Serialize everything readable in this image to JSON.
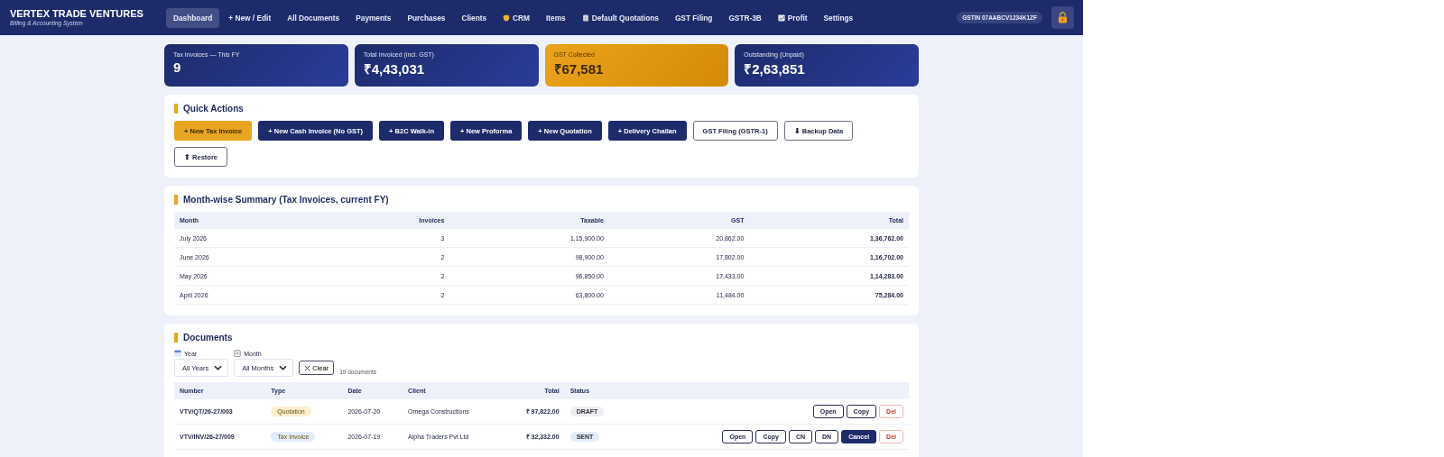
{
  "brand": {
    "title": "VERTEX TRADE VENTURES",
    "subtitle": "Billing & Accounting System"
  },
  "nav": [
    {
      "label": "Dashboard",
      "selected": true
    },
    {
      "label": "+ New / Edit",
      "selected": false
    },
    {
      "label": "All Documents",
      "selected": false
    },
    {
      "label": "Payments",
      "selected": false
    },
    {
      "label": "Purchases",
      "selected": false
    },
    {
      "label": "Clients",
      "selected": false
    },
    {
      "label": "CRM",
      "selected": false
    },
    {
      "label": "Items",
      "selected": false
    },
    {
      "label": "Default Quotations",
      "selected": false
    },
    {
      "label": "GST Filing",
      "selected": false
    },
    {
      "label": "GSTR-3B",
      "selected": false
    },
    {
      "label": "Profit",
      "selected": false
    },
    {
      "label": "Settings",
      "selected": false
    }
  ],
  "gstin": "GSTIN 07AABCV1234K1ZF",
  "stats": [
    {
      "label": "Tax Invoices — This FY",
      "value": "9",
      "kind": "primary"
    },
    {
      "label": "Total Invoiced (incl. GST)",
      "value": "₹4,43,031",
      "kind": "primary"
    },
    {
      "label": "GST Collected",
      "value": "₹67,581",
      "kind": "accent"
    },
    {
      "label": "Outstanding (Unpaid)",
      "value": "₹2,63,851",
      "kind": "primary"
    }
  ],
  "quick_actions": {
    "title": "Quick Actions",
    "buttons": [
      {
        "label": "+ New Tax Invoice",
        "kind": "accent"
      },
      {
        "label": "+ New Cash Invoice (No GST)",
        "kind": "dark"
      },
      {
        "label": "+ B2C Walk-in",
        "kind": "dark"
      },
      {
        "label": "+ New Proforma",
        "kind": "dark"
      },
      {
        "label": "+ New Quotation",
        "kind": "dark"
      },
      {
        "label": "+ Delivery Challan",
        "kind": "dark"
      },
      {
        "label": "GST Filing (GSTR-1)",
        "kind": "outline"
      },
      {
        "label": "⬇ Backup Data",
        "kind": "outline"
      },
      {
        "label": "⬆ Restore",
        "kind": "outline"
      }
    ]
  },
  "summary": {
    "title": "Month-wise Summary (Tax Invoices, current FY)",
    "columns": [
      "Month",
      "Invoices",
      "Taxable",
      "GST",
      "Total"
    ],
    "rows": [
      [
        "July 2026",
        "3",
        "1,15,900.00",
        "20,862.00",
        "1,36,762.00"
      ],
      [
        "June 2026",
        "2",
        "98,900.00",
        "17,802.00",
        "1,16,702.00"
      ],
      [
        "May 2026",
        "2",
        "96,850.00",
        "17,433.00",
        "1,14,283.00"
      ],
      [
        "April 2026",
        "2",
        "63,800.00",
        "11,484.00",
        "75,284.00"
      ]
    ]
  },
  "documents": {
    "title": "Documents",
    "filters": [
      {
        "label": "Year",
        "value": "All Years"
      },
      {
        "label": "Month",
        "value": "All Months"
      }
    ],
    "clear": "Clear",
    "count": "19 documents",
    "columns": [
      "Number",
      "Type",
      "Date",
      "Client",
      "Total",
      "Status"
    ],
    "rows": [
      {
        "number": "VTV/QT/26-27/003",
        "type": {
          "label": "Quotation",
          "color": "#fdf0d0"
        },
        "date": "2026-07-20",
        "client": "Omega Constructions",
        "total": "₹ 97,822.00",
        "status": {
          "label": "DRAFT",
          "color": "#eceef3"
        },
        "actions": [
          {
            "label": "Open",
            "kind": "outline"
          },
          {
            "label": "Copy",
            "kind": "outline"
          },
          {
            "label": "Del",
            "kind": "danger"
          }
        ]
      },
      {
        "number": "VTV/INV/26-27/009",
        "type": {
          "label": "Tax Invoice",
          "color": "#e3ecfb"
        },
        "date": "2026-07-19",
        "client": "Alpha Traders Pvt Ltd",
        "total": "₹ 32,332.00",
        "status": {
          "label": "SENT",
          "color": "#e3ecfb"
        },
        "actions": [
          {
            "label": "Open",
            "kind": "outline"
          },
          {
            "label": "Copy",
            "kind": "outline"
          },
          {
            "label": "CN",
            "kind": "outline"
          },
          {
            "label": "DN",
            "kind": "outline"
          },
          {
            "label": "Cancel",
            "kind": "dark"
          },
          {
            "label": "Del",
            "kind": "danger"
          }
        ]
      }
    ]
  }
}
